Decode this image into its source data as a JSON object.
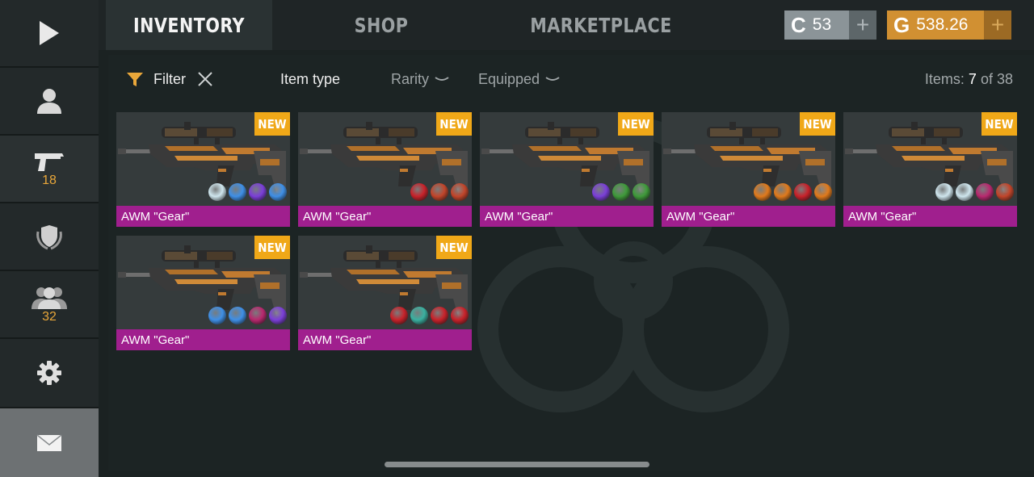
{
  "sidebar": {
    "weapons_count": "18",
    "friends_count": "32"
  },
  "tabs": [
    {
      "label": "INVENTORY",
      "active": true
    },
    {
      "label": "SHOP",
      "active": false
    },
    {
      "label": "MARKETPLACE",
      "active": false
    }
  ],
  "currency": {
    "silver": {
      "value": "53",
      "icon": "C",
      "plus": "+"
    },
    "gold": {
      "value": "538.26",
      "icon": "G",
      "plus": "+"
    }
  },
  "filters": {
    "filter_label": "Filter",
    "item_type": "Item type",
    "rarity": "Rarity",
    "equipped": "Equipped",
    "items_prefix": "Items:",
    "items_shown": "7",
    "items_of": "of",
    "items_total": "38"
  },
  "items": [
    {
      "name": "AWM \"Gear\"",
      "badge": "NEW",
      "stickers": [
        "ghost",
        "blue",
        "purple",
        "blue"
      ]
    },
    {
      "name": "AWM \"Gear\"",
      "badge": "NEW",
      "stickers": [
        "red",
        "orange-red",
        "orange-red"
      ]
    },
    {
      "name": "AWM \"Gear\"",
      "badge": "NEW",
      "stickers": [
        "purple",
        "green",
        "green"
      ]
    },
    {
      "name": "AWM \"Gear\"",
      "badge": "NEW",
      "stickers": [
        "orange",
        "orange",
        "red",
        "orange"
      ]
    },
    {
      "name": "AWM \"Gear\"",
      "badge": "NEW",
      "stickers": [
        "ghost",
        "ghost",
        "magenta",
        "orange-red"
      ]
    },
    {
      "name": "AWM \"Gear\"",
      "badge": "NEW",
      "stickers": [
        "blue",
        "blue",
        "magenta",
        "purple"
      ]
    },
    {
      "name": "AWM \"Gear\"",
      "badge": "NEW",
      "stickers": [
        "red",
        "teal",
        "red",
        "red"
      ]
    }
  ],
  "sticker_colors": {
    "ghost": "#cfe6ee",
    "blue": "#3f8fe6",
    "purple": "#7b3fd8",
    "red": "#c8222a",
    "orange-red": "#c2452a",
    "green": "#3f9a3a",
    "orange": "#e07a1c",
    "magenta": "#b8286e",
    "teal": "#3ab0a0"
  },
  "colors": {
    "accent_gold": "#d19032",
    "new_badge": "#f0a818",
    "item_name_bar": "#a01f8e"
  }
}
